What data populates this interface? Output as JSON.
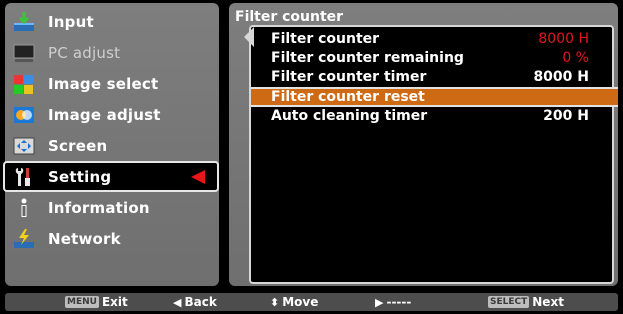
{
  "left_menu": {
    "items": [
      {
        "label": "Input",
        "icon": "input-icon",
        "disabled": false
      },
      {
        "label": "PC adjust",
        "icon": "pc-adjust-icon",
        "disabled": true
      },
      {
        "label": "Image select",
        "icon": "image-select-icon",
        "disabled": false
      },
      {
        "label": "Image adjust",
        "icon": "image-adjust-icon",
        "disabled": false
      },
      {
        "label": "Screen",
        "icon": "screen-icon",
        "disabled": false
      },
      {
        "label": "Setting",
        "icon": "setting-icon",
        "disabled": false,
        "selected": true
      },
      {
        "label": "Information",
        "icon": "information-icon",
        "disabled": false
      },
      {
        "label": "Network",
        "icon": "network-icon",
        "disabled": false
      }
    ]
  },
  "submenu": {
    "title": "Filter counter",
    "rows": [
      {
        "label": "Filter counter",
        "value": "8000 H",
        "value_color": "#e2181b"
      },
      {
        "label": "Filter counter remaining",
        "value": "0 %",
        "value_color": "#e2181b"
      },
      {
        "label": "Filter counter timer",
        "value": "8000 H",
        "value_color": "#ffffff"
      },
      {
        "label": "Filter counter reset",
        "value": "",
        "highlighted": true
      },
      {
        "label": "Auto cleaning timer",
        "value": "200 H",
        "value_color": "#ffffff"
      }
    ]
  },
  "bottom_bar": {
    "exit_key": "MENU",
    "exit_label": "Exit",
    "back_label": "Back",
    "move_label": "Move",
    "right_label": "-----",
    "select_key": "SELECT",
    "next_label": "Next"
  },
  "colors": {
    "panel": "#777777",
    "highlight": "#cf6a14",
    "accent_red": "#e2181b"
  }
}
